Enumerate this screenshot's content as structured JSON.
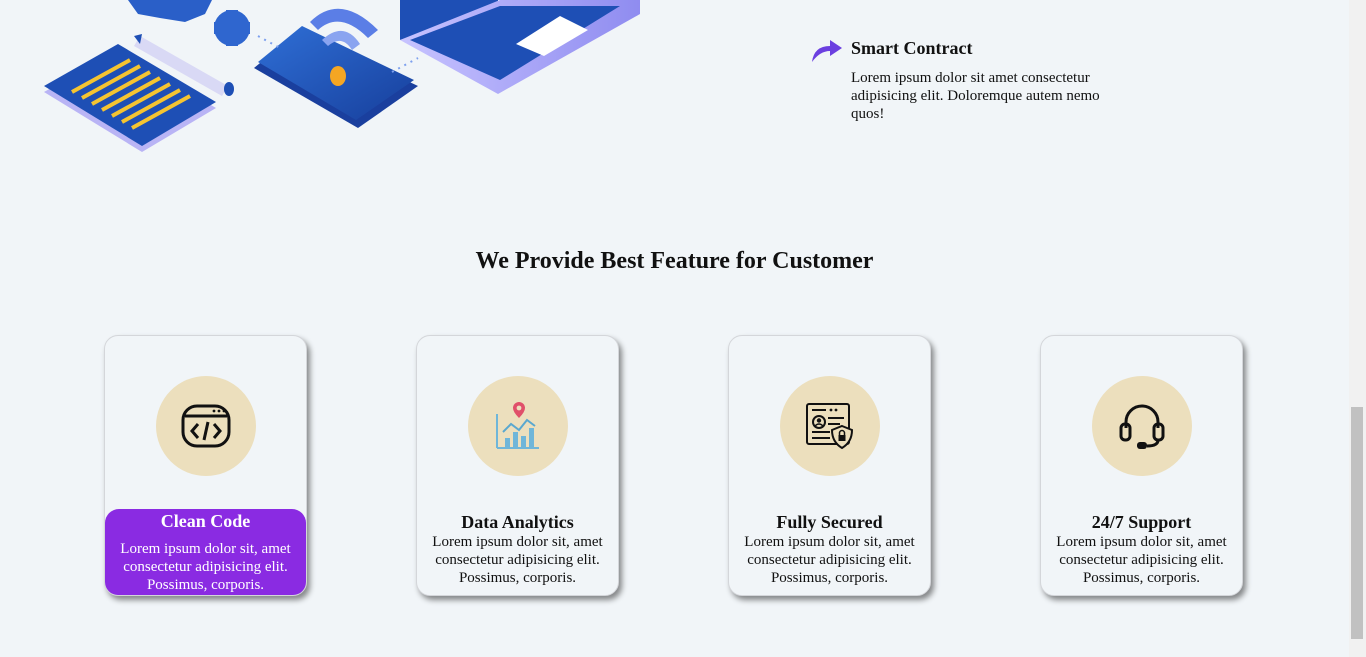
{
  "smart_contract": {
    "title": "Smart Contract",
    "text": "Lorem ipsum dolor sit amet consectetur adipisicing elit. Doloremque autem nemo quos!"
  },
  "features": {
    "title": "We Provide Best Feature for Customer",
    "cards": [
      {
        "title": "Clean Code",
        "text": "Lorem ipsum dolor sit, amet consectetur adipisicing elit. Possimus, corporis.",
        "icon": "code-window-icon",
        "active": true
      },
      {
        "title": "Data Analytics",
        "text": "Lorem ipsum dolor sit, amet consectetur adipisicing elit. Possimus, corporis.",
        "icon": "analytics-chart-icon",
        "active": false
      },
      {
        "title": "Fully Secured",
        "text": "Lorem ipsum dolor sit, amet consectetur adipisicing elit. Possimus, corporis.",
        "icon": "secure-document-icon",
        "active": false
      },
      {
        "title": "24/7 Support",
        "text": "Lorem ipsum dolor sit, amet consectetur adipisicing elit. Possimus, corporis.",
        "icon": "headset-icon",
        "active": false
      }
    ]
  },
  "colors": {
    "background": "#f1f5f8",
    "accent_purple": "#8a2be2",
    "badge_beige": "#ecdfbd",
    "illustration_blue": "#1f4fb0"
  }
}
